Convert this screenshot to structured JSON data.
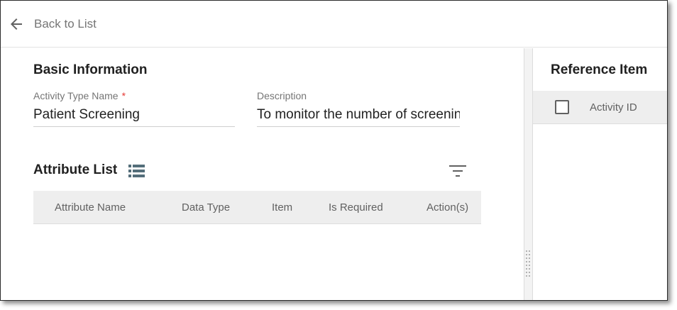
{
  "header": {
    "back_icon": "arrow-left-icon",
    "back_label": "Back to List"
  },
  "basic_info": {
    "title": "Basic Information",
    "activity_type_name": {
      "label": "Activity Type Name",
      "required_mark": "*",
      "value": "Patient Screening"
    },
    "description": {
      "label": "Description",
      "value": "To monitor the number of screenings"
    }
  },
  "attribute_list": {
    "title": "Attribute List",
    "list_icon": "list-view-icon",
    "filter_icon": "filter-icon",
    "columns": [
      "Attribute Name",
      "Data Type",
      "Item",
      "Is Required",
      "Action(s)"
    ],
    "rows": []
  },
  "reference_item": {
    "title": "Reference Item",
    "columns": [
      "Activity ID"
    ],
    "select_all_checked": false,
    "rows": []
  },
  "colors": {
    "required": "#e53935",
    "table_header_bg": "#eeeeee",
    "text_primary": "#212121",
    "text_secondary": "#757575"
  }
}
